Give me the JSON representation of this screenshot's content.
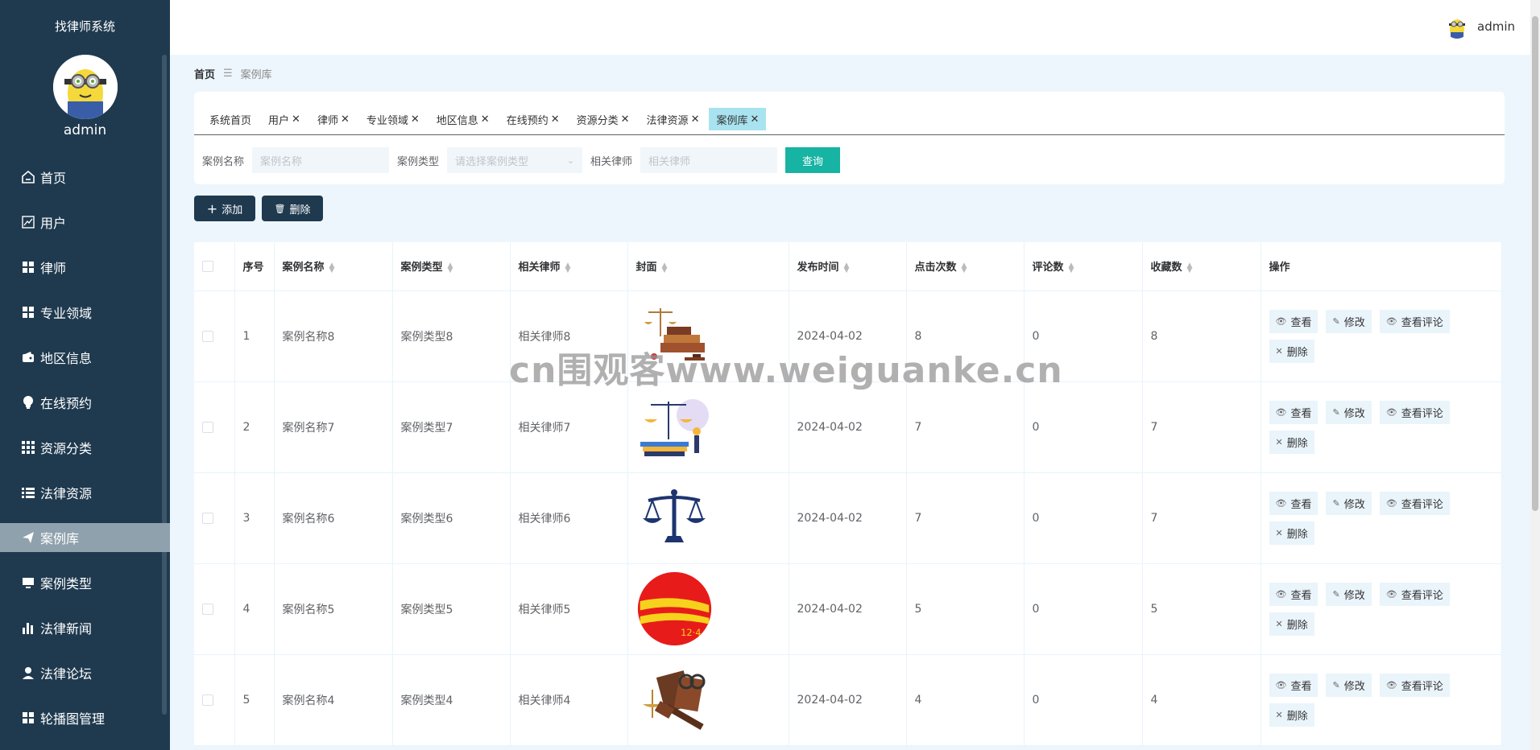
{
  "sidebar": {
    "title": "找律师系统",
    "username": "admin",
    "items": [
      {
        "label": "首页",
        "icon": "home-icon"
      },
      {
        "label": "用户",
        "icon": "chart-line-icon"
      },
      {
        "label": "律师",
        "icon": "grid-icon"
      },
      {
        "label": "专业领域",
        "icon": "grid-icon"
      },
      {
        "label": "地区信息",
        "icon": "wallet-icon"
      },
      {
        "label": "在线预约",
        "icon": "lightbulb-icon"
      },
      {
        "label": "资源分类",
        "icon": "apps-icon"
      },
      {
        "label": "法律资源",
        "icon": "list-icon"
      },
      {
        "label": "案例库",
        "icon": "send-icon",
        "active": true
      },
      {
        "label": "案例类型",
        "icon": "monitor-icon"
      },
      {
        "label": "法律新闻",
        "icon": "bar-chart-icon"
      },
      {
        "label": "法律论坛",
        "icon": "user-icon"
      },
      {
        "label": "轮播图管理",
        "icon": "grid-icon"
      }
    ]
  },
  "header": {
    "username": "admin"
  },
  "breadcrumb": {
    "home": "首页",
    "current": "案例库"
  },
  "tabs": [
    {
      "label": "系统首页",
      "closable": false
    },
    {
      "label": "用户",
      "closable": true
    },
    {
      "label": "律师",
      "closable": true
    },
    {
      "label": "专业领域",
      "closable": true
    },
    {
      "label": "地区信息",
      "closable": true
    },
    {
      "label": "在线预约",
      "closable": true
    },
    {
      "label": "资源分类",
      "closable": true
    },
    {
      "label": "法律资源",
      "closable": true
    },
    {
      "label": "案例库",
      "closable": true,
      "active": true
    }
  ],
  "tab_close": "✕",
  "search": {
    "name_label": "案例名称",
    "name_placeholder": "案例名称",
    "type_label": "案例类型",
    "type_placeholder": "请选择案例类型",
    "lawyer_label": "相关律师",
    "lawyer_placeholder": "相关律师",
    "query_button": "查询"
  },
  "actions": {
    "add": "添加",
    "delete": "删除"
  },
  "table": {
    "headers": {
      "index": "序号",
      "name": "案例名称",
      "type": "案例类型",
      "lawyer": "相关律师",
      "cover": "封面",
      "time": "发布时间",
      "clicks": "点击次数",
      "comments": "评论数",
      "favorites": "收藏数",
      "ops": "操作"
    },
    "op_labels": {
      "view": "查看",
      "edit": "修改",
      "comments": "查看评论",
      "delete": "删除"
    },
    "rows": [
      {
        "index": "1",
        "name": "案例名称8",
        "type": "案例类型8",
        "lawyer": "相关律师8",
        "cover": "scales-books-image",
        "time": "2024-04-02",
        "clicks": "8",
        "comments": "0",
        "favorites": "8"
      },
      {
        "index": "2",
        "name": "案例名称7",
        "type": "案例类型7",
        "lawyer": "相关律师7",
        "cover": "justice-illustration-image",
        "time": "2024-04-02",
        "clicks": "7",
        "comments": "0",
        "favorites": "7"
      },
      {
        "index": "3",
        "name": "案例名称6",
        "type": "案例类型6",
        "lawyer": "相关律师6",
        "cover": "scales-icon-image",
        "time": "2024-04-02",
        "clicks": "7",
        "comments": "0",
        "favorites": "7"
      },
      {
        "index": "4",
        "name": "案例名称5",
        "type": "案例类型5",
        "lawyer": "相关律师5",
        "cover": "law-day-logo-image",
        "time": "2024-04-02",
        "clicks": "5",
        "comments": "0",
        "favorites": "5"
      },
      {
        "index": "5",
        "name": "案例名称4",
        "type": "案例类型4",
        "lawyer": "相关律师4",
        "cover": "gavel-books-image",
        "time": "2024-04-02",
        "clicks": "4",
        "comments": "0",
        "favorites": "4"
      }
    ]
  },
  "watermark": "cn围观客www.weiguanke.cn",
  "colors": {
    "sidebar": "#1f3a4f",
    "active_menu": "#8fa1ad",
    "query_button": "#17b3a3",
    "active_tab": "#a8e3ef"
  }
}
